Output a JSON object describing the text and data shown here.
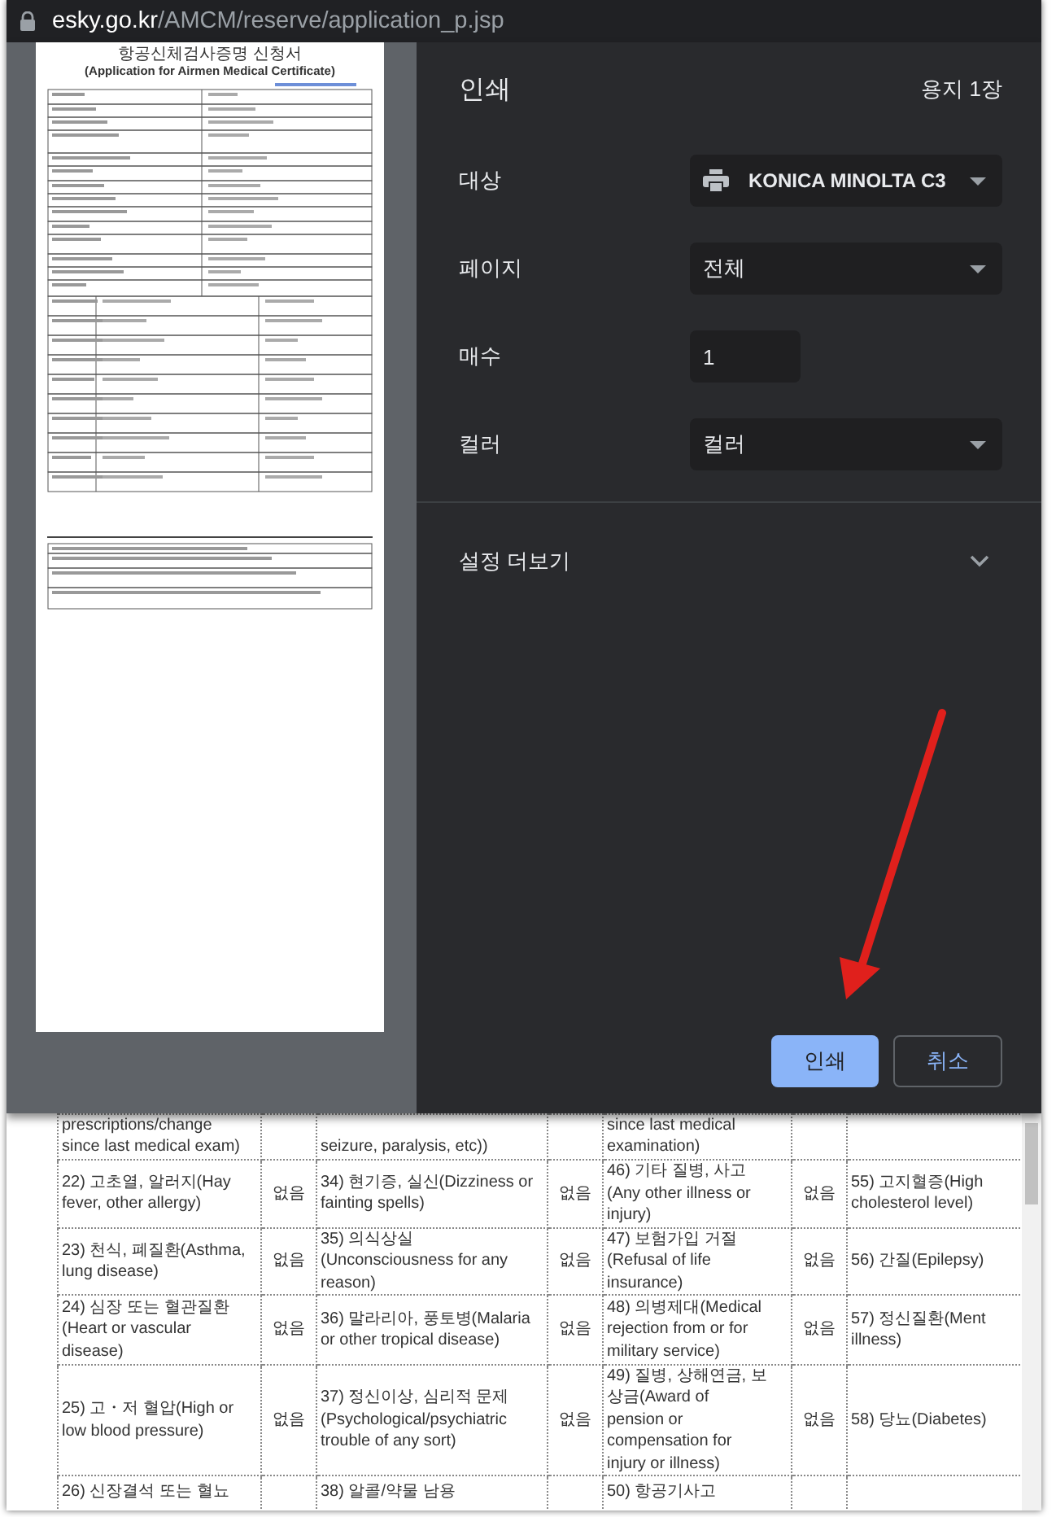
{
  "address_bar": {
    "domain": "esky.go.kr",
    "path": "/AMCM/reserve/application_p.jsp"
  },
  "preview": {
    "title": "항공신체검사증명 신청서",
    "subtitle": "(Application for Airmen Medical Certificate)"
  },
  "print_dialog": {
    "title": "인쇄",
    "sheets": "용지 1장",
    "settings": [
      {
        "label": "대상",
        "kind": "printer",
        "value": "KONICA MINOLTA C3"
      },
      {
        "label": "페이지",
        "kind": "select",
        "value": "전체"
      },
      {
        "label": "매수",
        "kind": "number",
        "value": "1"
      },
      {
        "label": "컬러",
        "kind": "select",
        "value": "컬러"
      }
    ],
    "more_settings": {
      "label": "설정 더보기",
      "expanded": false
    },
    "buttons": [
      {
        "label": "인쇄",
        "kind": "primary"
      },
      {
        "label": "취소",
        "kind": "secondary"
      }
    ]
  },
  "table": {
    "rows": [
      {
        "item_1": [
          "prescriptions/change",
          "since last medical exam)"
        ],
        "item_2": [
          "seizure, paralysis, etc))"
        ],
        "item_3": [
          "since last medical",
          "examination)"
        ]
      },
      {
        "item_1": [
          "22) 고초열, 알러지(Hay",
          "fever, other allergy)"
        ],
        "answer_1": "없음",
        "item_2": [
          "34) 현기증, 실신(Dizziness or",
          "fainting spells)"
        ],
        "answer_2": "없음",
        "item_3": [
          "46) 기타 질병, 사고",
          "(Any other illness or",
          "injury)"
        ],
        "answer_3": "없음",
        "item_4": [
          "55) 고지혈증(High",
          "cholesterol level)"
        ]
      },
      {
        "item_1": [
          "23) 천식, 폐질환(Asthma,",
          "lung disease)"
        ],
        "answer_1": "없음",
        "item_2": [
          "35) 의식상실",
          "(Unconsciousness for any",
          "reason)"
        ],
        "answer_2": "없음",
        "item_3": [
          "47) 보험가입 거절",
          "(Refusal of life",
          "insurance)"
        ],
        "answer_3": "없음",
        "item_4": [
          "56) 간질(Epilepsy)"
        ]
      },
      {
        "item_1": [
          "24) 심장 또는 혈관질환",
          "(Heart or vascular",
          "disease)"
        ],
        "answer_1": "없음",
        "item_2": [
          "36) 말라리아, 풍토병(Malaria",
          "or other tropical disease)"
        ],
        "answer_2": "없음",
        "item_3": [
          "48) 의병제대(Medical",
          "rejection from or for",
          "military service)"
        ],
        "answer_3": "없음",
        "item_4": [
          "57) 정신질환(Ment",
          "illness)"
        ]
      },
      {
        "item_1": [
          "25) 고・저 혈압(High or",
          "low blood pressure)"
        ],
        "answer_1": "없음",
        "item_2": [
          "37) 정신이상, 심리적 문제",
          "(Psychological/psychiatric",
          "trouble of any sort)"
        ],
        "answer_2": "없음",
        "item_3": [
          "49) 질병, 상해연금, 보",
          "상금(Award of",
          "pension or",
          "compensation for",
          "injury or illness)"
        ],
        "answer_3": "없음",
        "item_4": [
          "58) 당뇨(Diabetes)"
        ]
      },
      {
        "item_1": [
          "26) 신장결석 또는 혈뇨"
        ],
        "item_2": [
          "38) 알콜/약물 남용"
        ],
        "item_3": [
          "50) 항공기사고"
        ]
      }
    ]
  }
}
